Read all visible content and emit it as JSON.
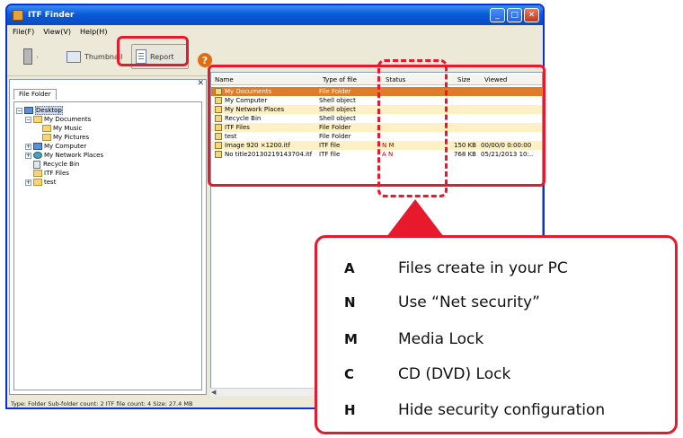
{
  "window": {
    "title": "ITF Finder"
  },
  "menu": [
    "File(F)",
    "View(V)",
    "Help(H)"
  ],
  "toolbar": {
    "thumbnail_label": "Thumbnail",
    "report_label": "Report"
  },
  "left_pane": {
    "tab_label": "File Folder",
    "tree": [
      {
        "label": "Desktop",
        "indent": 0,
        "icon": "desktop-icon",
        "expander": "minus",
        "selected": true
      },
      {
        "label": "My Documents",
        "indent": 1,
        "icon": "folder-icon",
        "expander": "minus"
      },
      {
        "label": "My Music",
        "indent": 2,
        "icon": "folder-icon",
        "expander": ""
      },
      {
        "label": "My Pictures",
        "indent": 2,
        "icon": "folder-icon",
        "expander": ""
      },
      {
        "label": "My Computer",
        "indent": 1,
        "icon": "computer-icon",
        "expander": "plus"
      },
      {
        "label": "My Network Places",
        "indent": 1,
        "icon": "network-icon",
        "expander": "plus"
      },
      {
        "label": "Recycle Bin",
        "indent": 1,
        "icon": "recycle-bin-icon",
        "expander": ""
      },
      {
        "label": "ITF Files",
        "indent": 1,
        "icon": "folder-icon",
        "expander": ""
      },
      {
        "label": "test",
        "indent": 1,
        "icon": "folder-icon",
        "expander": "plus"
      }
    ]
  },
  "file_list": {
    "columns": [
      "Name",
      "Type of file",
      "Status",
      "Size",
      "Viewed"
    ],
    "rows": [
      {
        "name": "My Documents",
        "type": "File Folder",
        "status": "",
        "size": "",
        "viewed": "",
        "style": "selected"
      },
      {
        "name": "My Computer",
        "type": "Shell object",
        "status": "",
        "size": "",
        "viewed": "",
        "style": "odd"
      },
      {
        "name": "My Network Places",
        "type": "Shell object",
        "status": "",
        "size": "",
        "viewed": "",
        "style": "alt"
      },
      {
        "name": "Recycle Bin",
        "type": "Shell object",
        "status": "",
        "size": "",
        "viewed": "",
        "style": "odd"
      },
      {
        "name": "ITF Files",
        "type": "File Folder",
        "status": "",
        "size": "",
        "viewed": "",
        "style": "alt"
      },
      {
        "name": "test",
        "type": "File Folder",
        "status": "",
        "size": "",
        "viewed": "",
        "style": "odd"
      },
      {
        "name": "Image 920 ×1200.itf",
        "type": "ITF file",
        "status": "N M",
        "size": "150 KB",
        "viewed": "00/00/0 0:00:00",
        "style": "alt"
      },
      {
        "name": "No title20130219143704.itf",
        "type": "ITF file",
        "status": "A N",
        "size": "768 KB",
        "viewed": "05/21/2013 10:..",
        "style": "odd"
      }
    ]
  },
  "status_bar": "Type: Folder  Sub-folder count: 2  ITF file count: 4  Size: 27.4 MB",
  "legend": [
    {
      "code": "A",
      "desc": "Files create in your PC"
    },
    {
      "code": "N",
      "desc": "Use “Net security”"
    },
    {
      "code": "M",
      "desc": "Media Lock"
    },
    {
      "code": "C",
      "desc": "CD (DVD) Lock"
    },
    {
      "code": "H",
      "desc": "Hide security configuration"
    }
  ],
  "colors": {
    "highlight_red": "#e8192c",
    "selected_row": "#e07b2a",
    "alt_row": "#fdf0c4"
  }
}
